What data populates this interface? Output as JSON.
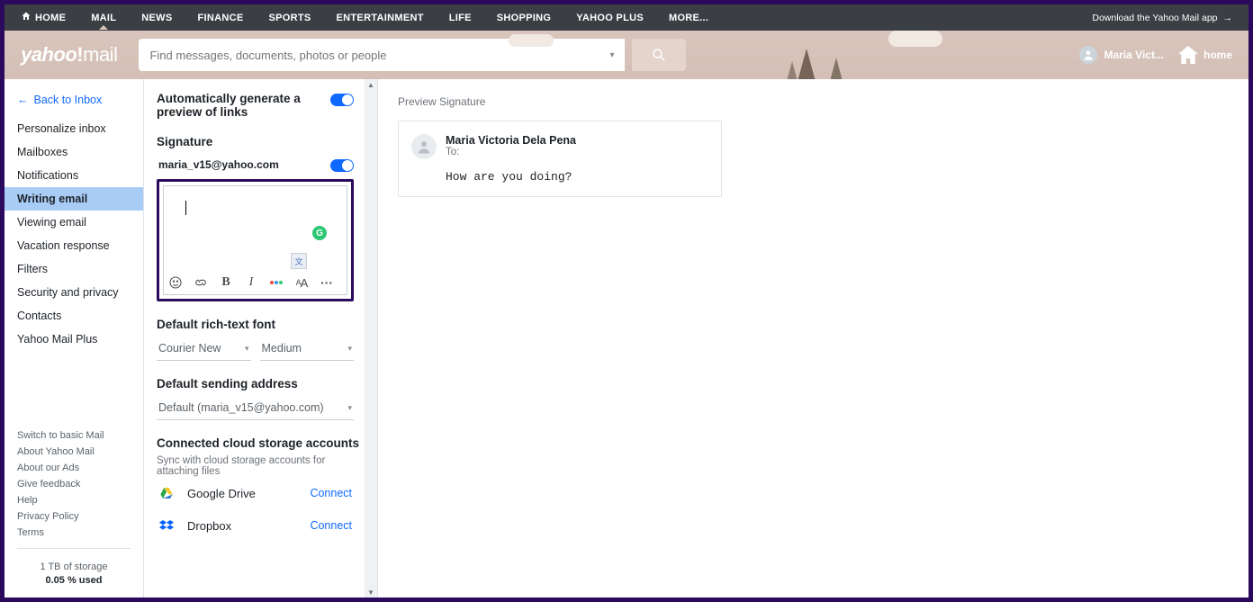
{
  "topnav": {
    "items": [
      "HOME",
      "MAIL",
      "NEWS",
      "FINANCE",
      "SPORTS",
      "ENTERTAINMENT",
      "LIFE",
      "SHOPPING",
      "YAHOO PLUS",
      "MORE..."
    ],
    "active_index": 1,
    "download": "Download the Yahoo Mail app"
  },
  "header": {
    "logo_left": "yahoo",
    "logo_right": "mail",
    "search_placeholder": "Find messages, documents, photos or people",
    "user_short": "Maria Vict...",
    "home_label": "home"
  },
  "sidebar": {
    "back": "Back to Inbox",
    "items": [
      "Personalize inbox",
      "Mailboxes",
      "Notifications",
      "Writing email",
      "Viewing email",
      "Vacation response",
      "Filters",
      "Security and privacy",
      "Contacts",
      "Yahoo Mail Plus"
    ],
    "active_index": 3,
    "footer": [
      "Switch to basic Mail",
      "About Yahoo Mail",
      "About our Ads",
      "Give feedback",
      "Help",
      "Privacy Policy",
      "Terms"
    ],
    "storage_line1": "1 TB of storage",
    "storage_line2": "0.05 % used"
  },
  "settings": {
    "autopreview": {
      "title": "Automatically generate a preview of links",
      "on": true
    },
    "signature": {
      "heading": "Signature",
      "email": "maria_v15@yahoo.com",
      "on": true,
      "body": ""
    },
    "font": {
      "heading": "Default rich-text font",
      "family": "Courier New",
      "size": "Medium"
    },
    "sending": {
      "heading": "Default sending address",
      "value": "Default (maria_v15@yahoo.com)"
    },
    "cloud": {
      "heading": "Connected cloud storage accounts",
      "sub": "Sync with cloud storage accounts for attaching files",
      "items": [
        {
          "name": "Google Drive",
          "action": "Connect"
        },
        {
          "name": "Dropbox",
          "action": "Connect"
        }
      ]
    }
  },
  "preview": {
    "heading": "Preview Signature",
    "from": "Maria Victoria Dela Pena",
    "to_label": "To:",
    "body": "How are you doing?"
  }
}
